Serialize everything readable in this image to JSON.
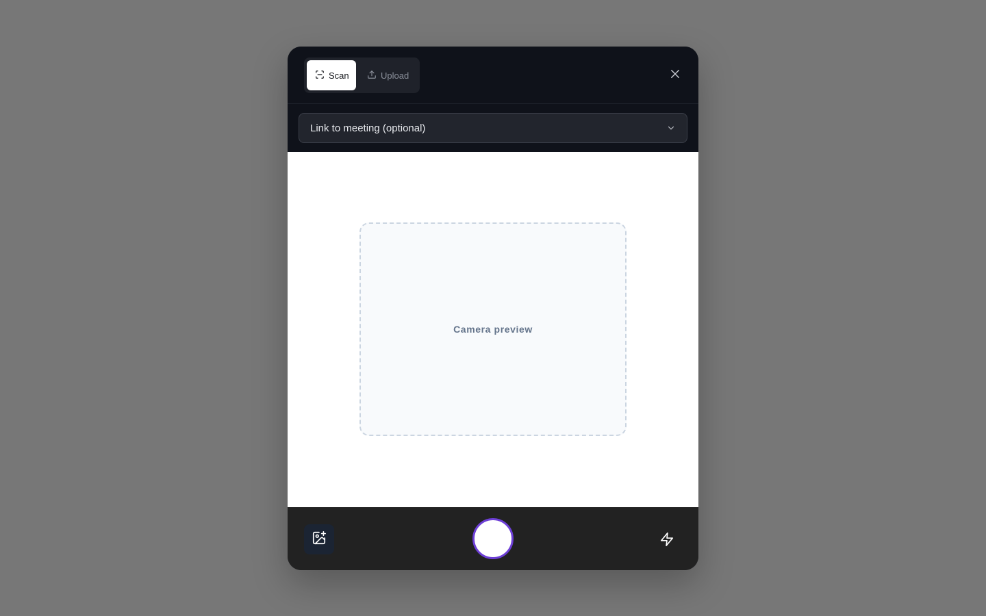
{
  "tabs": {
    "scan_label": "Scan",
    "upload_label": "Upload",
    "active": "Scan"
  },
  "meeting_select": {
    "value": "Link to meeting (optional)"
  },
  "preview": {
    "label": "Camera preview"
  },
  "icons": {
    "scan": "scan-icon",
    "upload": "upload-icon",
    "close": "close-icon",
    "chevron": "chevron-down-icon",
    "gallery": "image-plus-icon",
    "flash": "flash-icon"
  },
  "colors": {
    "backdrop": "#777777",
    "dark_panel": "#0f121a",
    "footer": "#222222",
    "shutter_ring": "#6d3fd6",
    "preview_border": "#cbd5e1",
    "preview_text": "#64748b"
  }
}
